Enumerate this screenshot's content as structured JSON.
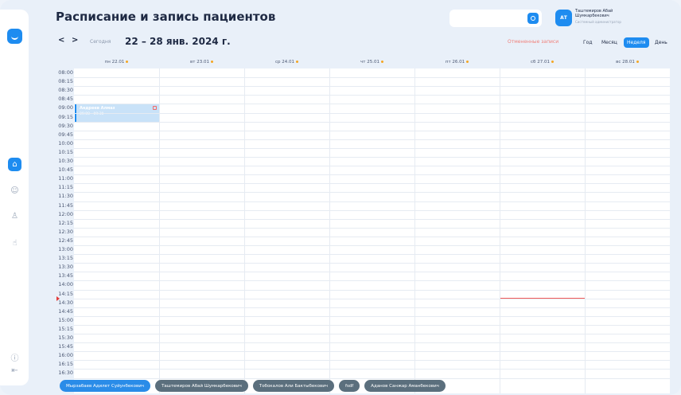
{
  "header": {
    "title": "Расписание и запись пациентов",
    "search_placeholder": "",
    "user": {
      "initials": "АТ",
      "name": "Таштемиров Абай Шумкарбекович",
      "role": "Системный администратор"
    }
  },
  "toolbar": {
    "prev": "<",
    "next": ">",
    "today": "Сегодня",
    "range": "22 – 28 янв. 2024 г.",
    "cancelled": "Отмененные записи",
    "views": [
      {
        "label": "Год",
        "active": false
      },
      {
        "label": "Месяц",
        "active": false
      },
      {
        "label": "Неделя",
        "active": true
      },
      {
        "label": "День",
        "active": false
      }
    ]
  },
  "days": [
    "пн 22.01",
    "вт 23.01",
    "ср 24.01",
    "чт 25.01",
    "пт 26.01",
    "сб 27.01",
    "вс 28.01"
  ],
  "times": [
    "08:00",
    "08:15",
    "08:30",
    "08:45",
    "09:00",
    "09:15",
    "09:30",
    "09:45",
    "10:00",
    "10:15",
    "10:30",
    "10:45",
    "11:00",
    "11:15",
    "11:30",
    "11:45",
    "12:00",
    "12:15",
    "12:30",
    "12:45",
    "13:00",
    "13:15",
    "13:30",
    "13:45",
    "14:00",
    "14:15",
    "14:30",
    "14:45",
    "15:00",
    "15:15",
    "15:30",
    "15:45",
    "16:00",
    "16:15",
    "16:30"
  ],
  "event": {
    "title": "Андреев Алмаз",
    "time": "09:00 - 09:30"
  },
  "doctors": [
    {
      "name": "Мырзабаев Адилет Суйунбекович",
      "active": true
    },
    {
      "name": "Таштемиров Абай Шумкарбекович",
      "active": false
    },
    {
      "name": "Тобокалов Али Бактыбекович",
      "active": false
    },
    {
      "name": "fsdf",
      "active": false
    },
    {
      "name": "Аданов Санжар Аманбекович",
      "active": false
    }
  ],
  "colors": {
    "accent": "#1e8cf0",
    "danger": "#f05a5a",
    "chip": "#5b6f7d"
  },
  "icons": {
    "sidebar": [
      "home-icon",
      "user-icon",
      "users-icon",
      "hand-icon",
      "info-icon",
      "logout-icon"
    ]
  }
}
